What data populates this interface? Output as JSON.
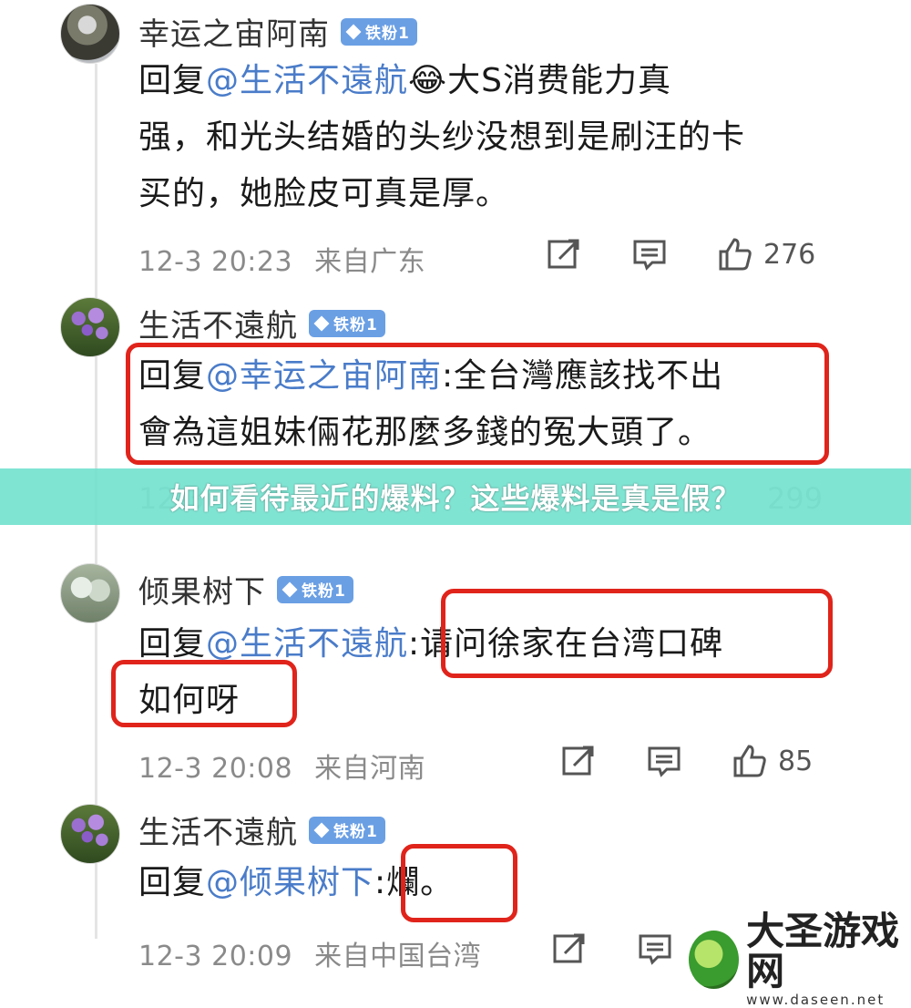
{
  "banner": {
    "text": "如何看待最近的爆料？这些爆料是真是假？"
  },
  "comments": [
    {
      "name": "幸运之宙阿南",
      "badge": "铁粉1",
      "reply_prefix": "回复",
      "mention": "@生活不遠航",
      "emoji": "😂",
      "body_line1": "大S消费能力真",
      "body_line2": "强，和光头结婚的头纱没想到是刷汪的卡",
      "body_line3": "买的，她脸皮可真是厚。",
      "time": "12-3 20:23",
      "from": "来自广东",
      "likes": "276"
    },
    {
      "name": "生活不遠航",
      "badge": "铁粉1",
      "reply_prefix": "回复",
      "mention": "@幸运之宙阿南",
      "body_line1": ":全台灣應該找不出",
      "body_line2": "會為這姐妹倆花那麼多錢的冤大頭了。",
      "time": "12-3",
      "likes": "299"
    },
    {
      "name": "倾果树下",
      "badge": "铁粉1",
      "reply_prefix": "回复",
      "mention": "@生活不遠航",
      "body_line1": ":请问徐家在台湾口碑",
      "body_line2": "如何呀",
      "time": "12-3 20:08",
      "from": "来自河南",
      "likes": "85"
    },
    {
      "name": "生活不遠航",
      "badge": "铁粉1",
      "reply_prefix": "回复",
      "mention": "@倾果树下",
      "body_line1": ":爛。",
      "time": "12-3 20:09",
      "from": "来自中国台湾"
    }
  ],
  "watermark": {
    "title": "大圣游戏网",
    "url": "www.daseen.net"
  },
  "icons": [
    "share-icon",
    "comment-icon",
    "like-icon"
  ]
}
